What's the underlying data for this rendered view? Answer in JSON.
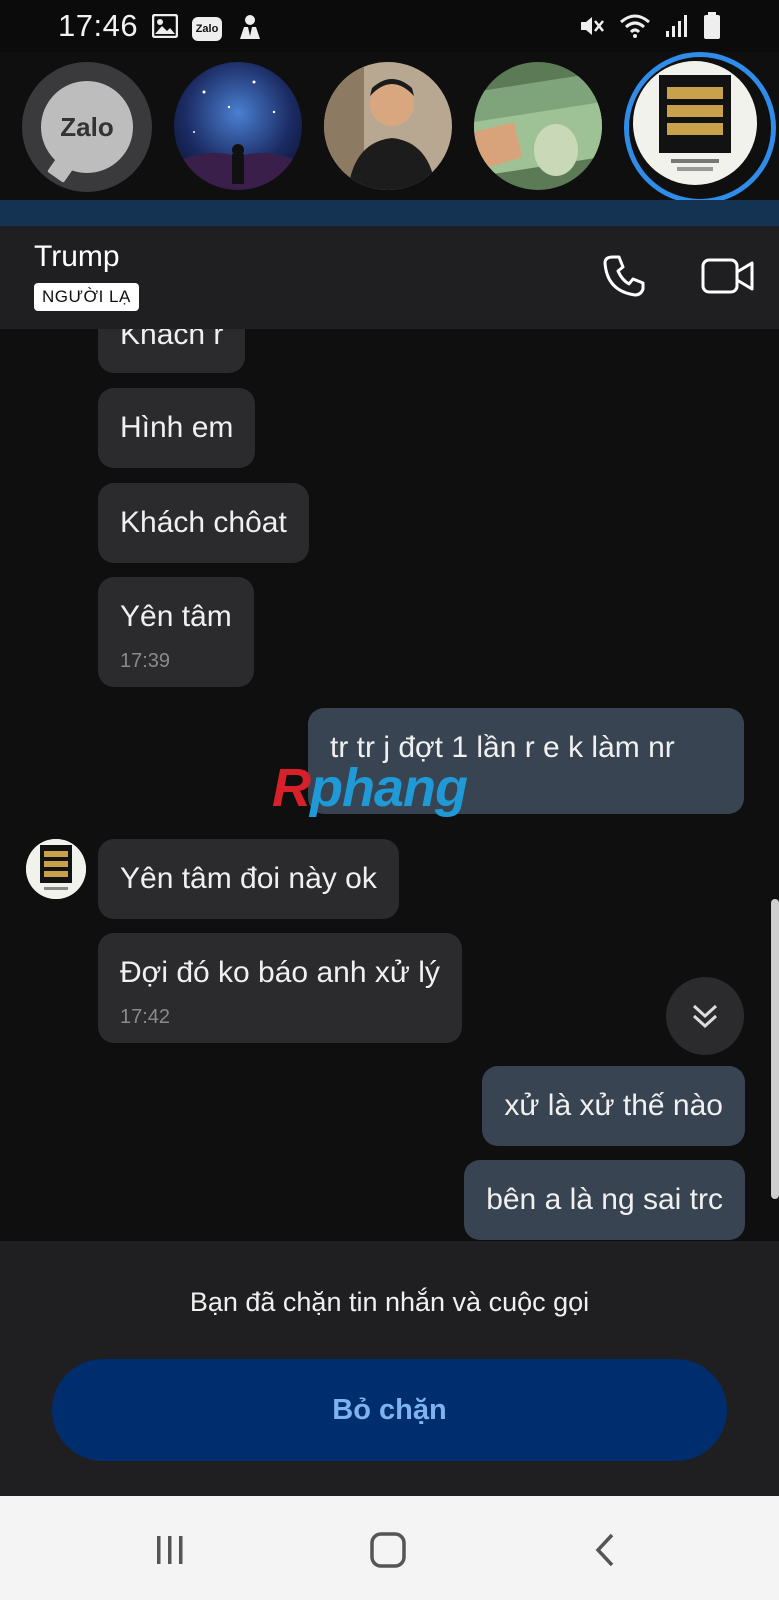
{
  "status_bar": {
    "time": "17:46",
    "zalo_badge": "Zalo",
    "icons_left": [
      "image-icon",
      "zalo-icon",
      "incognito-icon"
    ],
    "icons_right": [
      "mute-icon",
      "wifi-icon",
      "signal-icon",
      "battery-icon"
    ]
  },
  "chat_heads": {
    "zalo_label": "Zalo",
    "items": [
      "night-sky-avatar",
      "person-avatar",
      "money-avatar",
      "trump-poster-avatar"
    ],
    "active_index": 3
  },
  "header": {
    "title": "Trump",
    "badge": "NGƯỜI LẠ",
    "call_icon": "phone-icon",
    "video_icon": "video-icon"
  },
  "messages": [
    {
      "dir": "in",
      "text": "Khach r"
    },
    {
      "dir": "in",
      "text": "Hình em"
    },
    {
      "dir": "in",
      "text": "Khách chôat"
    },
    {
      "dir": "in",
      "text": "Yên tâm",
      "time": "17:39"
    },
    {
      "dir": "out",
      "text": "tr tr j đợt 1 lần r e k làm nr"
    },
    {
      "dir": "in",
      "text": "Yên tâm đoi này ok"
    },
    {
      "dir": "in",
      "text": "Đợi đó ko báo anh xử lý",
      "time": "17:42"
    },
    {
      "dir": "out",
      "text": "xử là xử thế nào"
    },
    {
      "dir": "out",
      "text": "bên a là ng sai trc"
    }
  ],
  "watermark": {
    "part1": "R",
    "part2": "phang"
  },
  "blocked": {
    "text": "Bạn đã chặn tin nhắn và cuộc gọi",
    "button_label": "Bỏ chặn"
  },
  "navbar": {
    "icons": [
      "recent-apps-icon",
      "home-icon",
      "back-icon"
    ]
  },
  "colors": {
    "accent_blue": "#2f8ce8",
    "unblock_bg": "#002d6e",
    "unblock_text": "#7fb2f0",
    "out_bubble": "#384451",
    "in_bubble": "#2b2b2e"
  }
}
